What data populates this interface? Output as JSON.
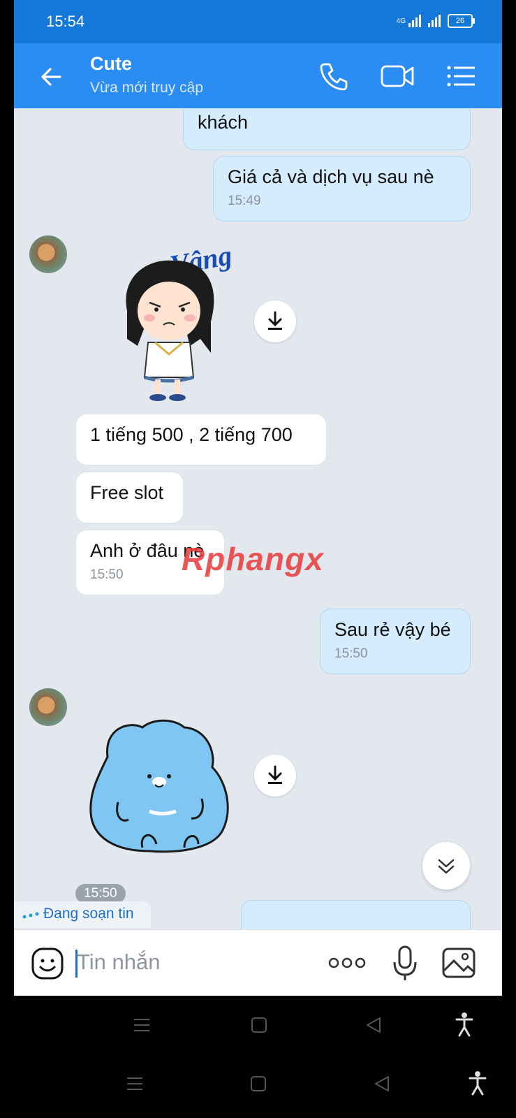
{
  "status_bar": {
    "time": "15:54",
    "network": "4G",
    "battery": "26"
  },
  "header": {
    "contact_name": "Cute",
    "presence": "Vừa mới truy cập"
  },
  "messages": {
    "out_partial_text": "khách",
    "out_1": {
      "text": "Giá cả và dịch vụ sau nè",
      "time": "15:49"
    },
    "sticker_1_caption": "Vâng",
    "in_1": {
      "text": "1 tiếng 500 , 2 tiếng 700"
    },
    "in_2": {
      "text": "Free slot"
    },
    "in_3": {
      "text": "Anh ở đâu nè",
      "time": "15:50"
    },
    "out_2": {
      "text": "Sau rẻ vậy bé",
      "time": "15:50"
    },
    "sticker_2_time": "15:50"
  },
  "typing_indicator": "Đang soạn tin",
  "composer": {
    "placeholder": "Tin nhắn"
  },
  "watermark": {
    "part1": "Rphang",
    "part2": "x"
  },
  "icons": {
    "header": [
      "back-arrow-icon",
      "phone-icon",
      "video-call-icon",
      "menu-icon"
    ],
    "composer": [
      "sticker-icon",
      "more-icon",
      "microphone-icon",
      "image-icon"
    ],
    "chat": [
      "download-icon",
      "scroll-down-icon"
    ]
  },
  "colors": {
    "header": "#2b8cf2",
    "status_bar": "#1478d8",
    "outgoing_bubble": "#d5ecfd",
    "incoming_bubble": "#ffffff",
    "chat_background": "#e3e8ef"
  }
}
